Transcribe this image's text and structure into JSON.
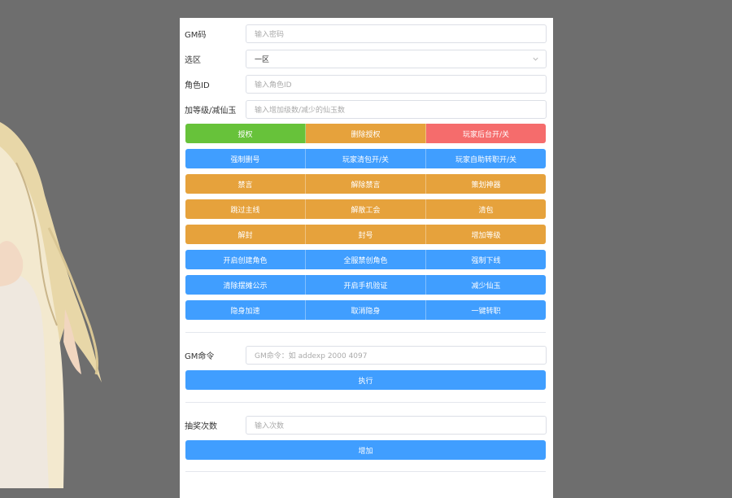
{
  "fields": {
    "gm_code": {
      "label": "GM码",
      "placeholder": "输入密码"
    },
    "region": {
      "label": "选区",
      "value": "一区"
    },
    "role_id": {
      "label": "角色ID",
      "placeholder": "输入角色ID"
    },
    "level_jade": {
      "label": "加等级/减仙玉",
      "placeholder": "输入增加级数/减少的仙玉数"
    }
  },
  "button_rows": [
    [
      {
        "label": "授权",
        "color": "#67c23a"
      },
      {
        "label": "删除授权",
        "color": "#e6a23c"
      },
      {
        "label": "玩家后台开/关",
        "color": "#f56c6c"
      }
    ],
    [
      {
        "label": "强制删号",
        "color": "#409eff"
      },
      {
        "label": "玩家清包开/关",
        "color": "#409eff"
      },
      {
        "label": "玩家自助转职开/关",
        "color": "#409eff"
      }
    ],
    [
      {
        "label": "禁言",
        "color": "#e6a23c"
      },
      {
        "label": "解除禁言",
        "color": "#e6a23c"
      },
      {
        "label": "策划神器",
        "color": "#e6a23c"
      }
    ],
    [
      {
        "label": "跳过主线",
        "color": "#e6a23c"
      },
      {
        "label": "解散工会",
        "color": "#e6a23c"
      },
      {
        "label": "清包",
        "color": "#e6a23c"
      }
    ],
    [
      {
        "label": "解封",
        "color": "#e6a23c"
      },
      {
        "label": "封号",
        "color": "#e6a23c"
      },
      {
        "label": "增加等级",
        "color": "#e6a23c"
      }
    ],
    [
      {
        "label": "开启创建角色",
        "color": "#409eff"
      },
      {
        "label": "全服禁创角色",
        "color": "#409eff"
      },
      {
        "label": "强制下线",
        "color": "#409eff"
      }
    ],
    [
      {
        "label": "清除摆摊公示",
        "color": "#409eff"
      },
      {
        "label": "开启手机验证",
        "color": "#409eff"
      },
      {
        "label": "减少仙玉",
        "color": "#409eff"
      }
    ],
    [
      {
        "label": "隐身加速",
        "color": "#409eff"
      },
      {
        "label": "取消隐身",
        "color": "#409eff"
      },
      {
        "label": "一键转职",
        "color": "#409eff"
      }
    ]
  ],
  "gm_command": {
    "label": "GM命令",
    "placeholder": "GM命令：如 addexp 2000 4097",
    "execute_label": "执行"
  },
  "lottery": {
    "label": "抽奖次数",
    "placeholder": "输入次数",
    "add_label": "增加"
  }
}
